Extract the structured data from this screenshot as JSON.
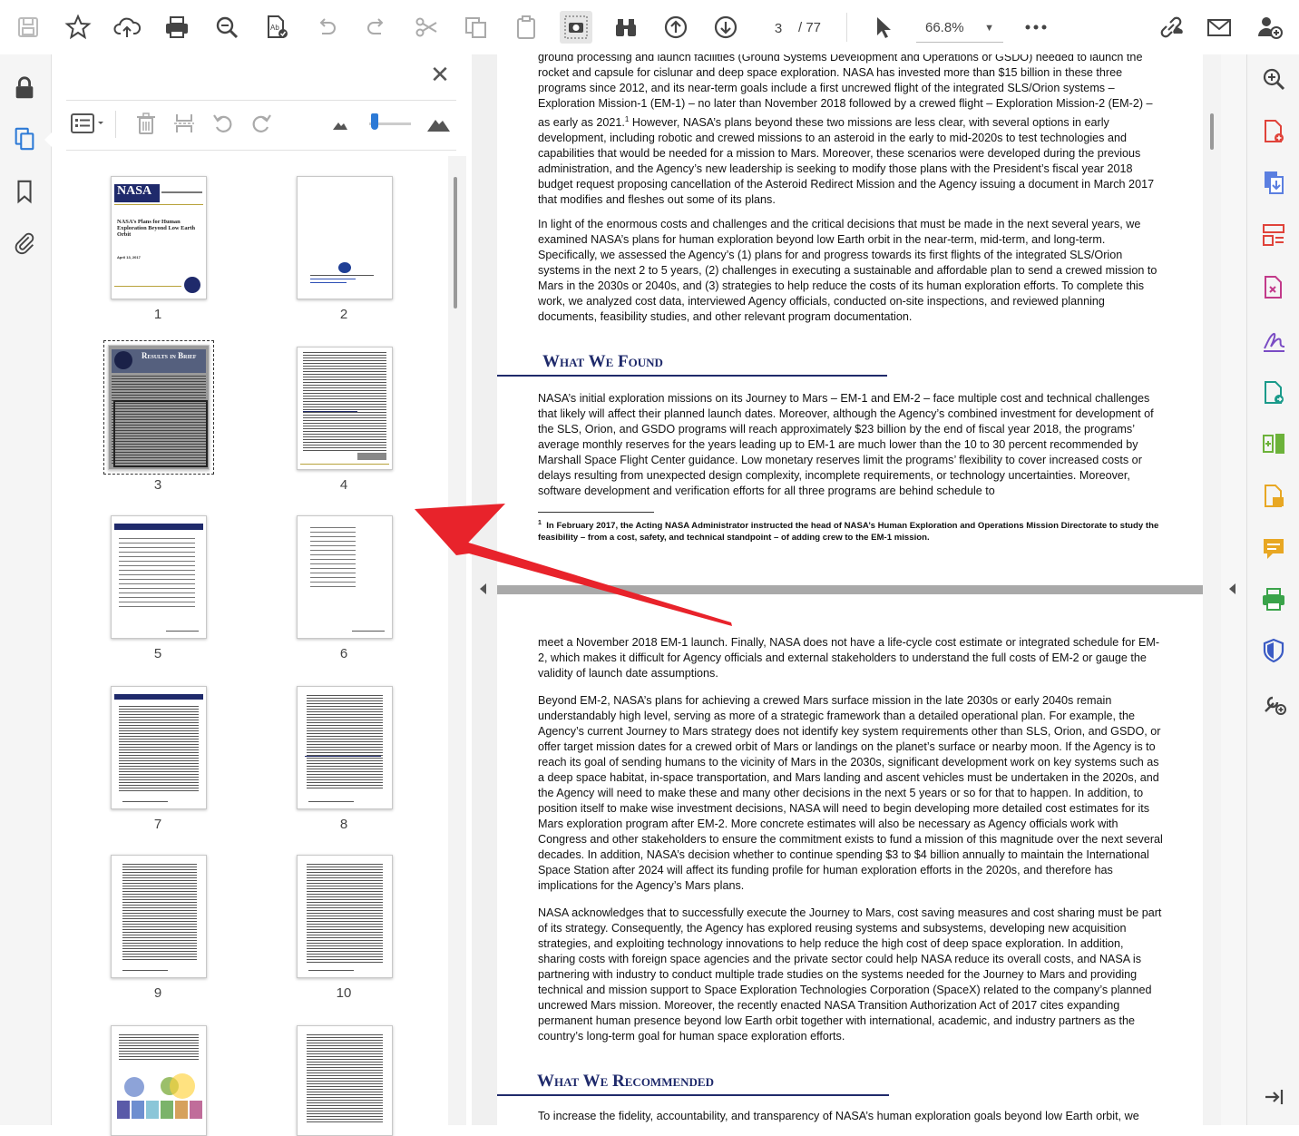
{
  "toolbar": {
    "current_page": "3",
    "total_pages": "/ 77",
    "zoom": "66.8%"
  },
  "thumbnails": [
    {
      "label": "1"
    },
    {
      "label": "2"
    },
    {
      "label": "3"
    },
    {
      "label": "4"
    },
    {
      "label": "5"
    },
    {
      "label": "6"
    },
    {
      "label": "7"
    },
    {
      "label": "8"
    },
    {
      "label": "9"
    },
    {
      "label": "10"
    }
  ],
  "thumb_texts": {
    "p1_logo": "NASA",
    "p1_title": "NASA’s Plans for Human Exploration Beyond Low Earth Orbit",
    "p1_date": "April 13, 2017",
    "p3_title": "Results in Brief"
  },
  "document": {
    "p1": "ground processing and launch facilities (Ground Systems Development and Operations or GSDO) needed to launch the rocket and capsule for cislunar and deep space exploration.  NASA has invested more than $15 billion in these three programs since 2012, and its near-term goals include a first uncrewed flight of the integrated SLS/Orion systems – Exploration Mission-1 (EM-1) – no later than November 2018 followed by a crewed flight – Exploration Mission-2 (EM-2) – as early as 2021.",
    "p1_sup": "1",
    "p1_rest": "  However, NASA’s plans beyond these two missions are less clear, with several options in early development, including robotic and crewed missions to an asteroid in the early to mid-2020s to test technologies and capabilities that would be needed for a mission to Mars.  Moreover, these scenarios were developed during the previous administration, and the Agency’s new leadership is seeking to modify those plans with the President’s fiscal year 2018 budget request proposing cancellation of the Asteroid Redirect Mission and the Agency issuing a document in March 2017 that modifies and fleshes out some of its plans.",
    "p2": "In light of the enormous costs and challenges and the critical decisions that must be made in the next several years, we examined NASA’s plans for human exploration beyond low Earth orbit in the near-term, mid-term, and long-term. Specifically, we assessed the Agency’s (1) plans for and progress towards its first flights of the integrated SLS/Orion systems in the next 2 to 5 years, (2) challenges in executing a sustainable and affordable plan to send a crewed mission to Mars in the 2030s or 2040s, and (3) strategies to help reduce the costs of its human exploration efforts.  To complete this work, we analyzed cost data, interviewed Agency officials, conducted on-site inspections, and reviewed planning documents, feasibility studies, and other relevant program documentation.",
    "heading_found": "What We Found",
    "p3": "NASA’s initial exploration missions on its Journey to Mars – EM-1 and EM-2 – face multiple cost and technical challenges that likely will affect their planned launch dates.  Moreover, although the Agency’s combined investment for development of the SLS, Orion, and GSDO programs will reach approximately $23 billion by the end of fiscal year 2018, the programs’ average monthly reserves for the years leading up to EM-1 are much lower than the 10 to 30 percent recommended by Marshall Space Flight Center guidance.  Low monetary reserves limit the programs’ flexibility to cover increased costs or delays resulting from unexpected design complexity, incomplete requirements, or technology uncertainties.  Moreover, software development and verification efforts for all three programs are behind schedule to",
    "footnote_num": "1",
    "footnote": "In February 2017, the Acting NASA Administrator instructed the head of NASA’s Human Exploration and Operations Mission Directorate to study the feasibility – from a cost, safety, and technical standpoint – of adding crew to the EM-1 mission.",
    "p4": "meet a November 2018 EM-1 launch.  Finally, NASA does not have a life-cycle cost estimate or integrated schedule for EM-2, which makes it difficult for Agency officials and external stakeholders to understand the full costs of EM-2 or gauge the validity of launch date assumptions.",
    "p5": "Beyond EM-2, NASA’s plans for achieving a crewed Mars surface mission in the late 2030s or early 2040s remain understandably high level, serving as more of a strategic framework than a detailed operational plan.  For example, the Agency’s current Journey to Mars strategy does not identify key system requirements other than SLS, Orion, and GSDO, or offer target mission dates for a crewed orbit of Mars or landings on the planet’s surface or nearby moon.  If the Agency is to reach its goal of sending humans to the vicinity of Mars in the 2030s, significant development work on key systems such as a deep space habitat, in-space transportation, and Mars landing and ascent vehicles must be undertaken in the 2020s, and the Agency will need to make these and many other decisions in the next 5 years or so for that to happen.  In addition, to position itself to make wise investment decisions, NASA will need to begin developing more detailed cost estimates for its Mars exploration program after EM-2.  More concrete estimates will also be necessary as Agency officials work with Congress and other stakeholders to ensure the commitment exists to fund a mission of this magnitude over the next several decades.  In addition, NASA’s decision whether to continue spending $3 to $4 billion annually to maintain the International Space Station after 2024 will affect its funding profile for human exploration efforts in the 2020s, and therefore has implications for the Agency’s Mars plans.",
    "p6": "NASA acknowledges that to successfully execute the Journey to Mars, cost saving measures and cost sharing must be part of its strategy.  Consequently, the Agency has explored reusing systems and subsystems, developing new acquisition strategies, and exploiting technology innovations to help reduce the high cost of deep space exploration. In addition, sharing costs with foreign space agencies and the private sector could help NASA reduce its overall costs, and NASA is partnering with industry to conduct multiple trade studies on the systems needed for the Journey to Mars and providing technical and mission support to Space Exploration Technologies Corporation (SpaceX) related to the company’s planned uncrewed Mars mission.  Moreover, the recently enacted NASA Transition Authorization Act of 2017 cites expanding permanent human presence beyond low Earth orbit together with international, academic, and industry partners as the country’s long-term goal for human space exploration efforts.",
    "heading_recommended": "What We Recommended",
    "p7": "To increase the fidelity, accountability, and transparency of NASA’s human exploration goals beyond low Earth orbit, we"
  },
  "colors": {
    "accent": "#2d7ad6",
    "annotation_arrow": "#e8232b",
    "heading_navy": "#1f2a6b"
  },
  "icons": {
    "toolbar": [
      "save-icon",
      "bookmark-star-icon",
      "cloud-upload-icon",
      "print-icon",
      "zoom-search-icon",
      "spellcheck-icon",
      "undo-icon",
      "redo-icon",
      "cut-icon",
      "copy-icon",
      "paste-icon",
      "snapshot-icon",
      "find-binoculars-icon",
      "previous-page-icon",
      "next-page-icon",
      "select-cursor-icon",
      "more-icon",
      "share-link-icon",
      "email-icon",
      "add-user-icon"
    ],
    "left_nav": [
      "lock-icon",
      "page-thumbnails-icon",
      "bookmarks-icon",
      "attachments-icon"
    ],
    "right_tools": [
      "zoom-tool-icon",
      "create-pdf-icon",
      "export-pdf-icon",
      "organize-pages-icon",
      "edit-pdf-icon",
      "fill-sign-icon",
      "send-for-review-icon",
      "compare-icon",
      "combine-icon",
      "comment-icon",
      "print-production-icon",
      "protect-icon",
      "more-tools-icon",
      "collapse-panel-icon"
    ]
  }
}
